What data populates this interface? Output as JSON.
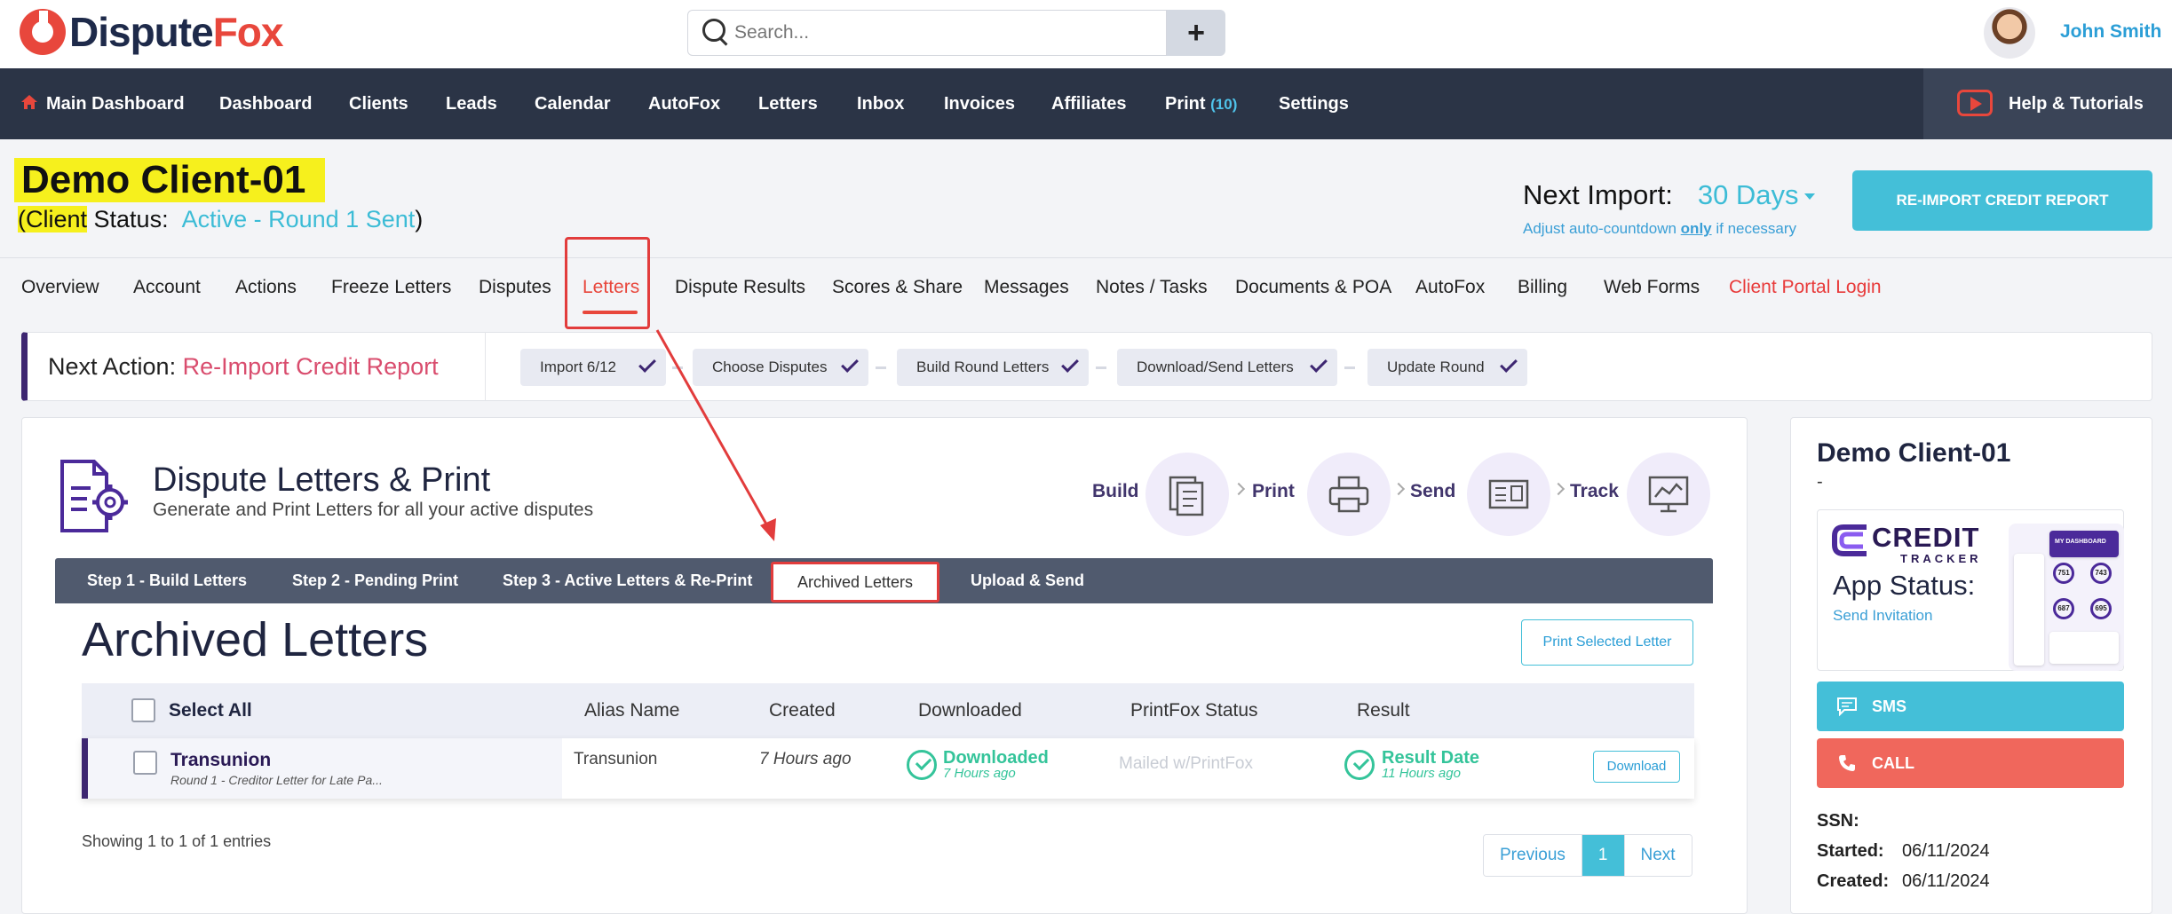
{
  "brand": {
    "name_part1": "Dispute",
    "name_part2": "Fox"
  },
  "search": {
    "placeholder": "Search..."
  },
  "add_button": "+",
  "user": {
    "name": "John Smith"
  },
  "nav": {
    "items": [
      {
        "label": "Main Dashboard"
      },
      {
        "label": "Dashboard"
      },
      {
        "label": "Clients"
      },
      {
        "label": "Leads"
      },
      {
        "label": "Calendar"
      },
      {
        "label": "AutoFox"
      },
      {
        "label": "Letters"
      },
      {
        "label": "Inbox"
      },
      {
        "label": "Invoices"
      },
      {
        "label": "Affiliates"
      },
      {
        "label": "Print",
        "count": "(10)"
      },
      {
        "label": "Settings"
      }
    ],
    "help": "Help & Tutorials"
  },
  "client": {
    "name": "Demo Client-01",
    "status_open": "(Client",
    "status_label": " Status:",
    "status_value": "Active - Round 1 Sent",
    "status_close": ")"
  },
  "next_import": {
    "label": "Next Import:",
    "value": "30 Days",
    "note_pre": "Adjust auto-countdown ",
    "note_bold": "only",
    "note_post": " if necessary",
    "button": "RE-IMPORT CREDIT REPORT"
  },
  "client_tabs": [
    "Overview",
    "Account",
    "Actions",
    "Freeze Letters",
    "Disputes",
    "Letters",
    "Dispute Results",
    "Scores & Share",
    "Messages",
    "Notes / Tasks",
    "Documents & POA",
    "AutoFox",
    "Billing",
    "Web Forms",
    "Client Portal Login"
  ],
  "active_client_tab": "Letters",
  "next_action": {
    "label": "Next Action:",
    "value": "Re-Import Credit Report",
    "steps": [
      "Import 6/12",
      "Choose Disputes",
      "Build Round Letters",
      "Download/Send Letters",
      "Update Round"
    ]
  },
  "letters_panel": {
    "title": "Dispute Letters & Print",
    "subtitle": "Generate and Print Letters for all your active disputes",
    "flow": [
      "Build",
      "Print",
      "Send",
      "Track"
    ],
    "tabs": [
      "Step 1 - Build Letters",
      "Step 2 - Pending Print",
      "Step 3 - Active Letters & Re-Print",
      "Archived Letters",
      "Upload & Send"
    ],
    "active_tab": "Archived Letters"
  },
  "archived": {
    "title": "Archived Letters",
    "print_selected": "Print Selected Letter",
    "columns": [
      "Select All",
      "Alias Name",
      "Created",
      "Downloaded",
      "PrintFox Status",
      "Result"
    ],
    "rows": [
      {
        "bureau": "Transunion",
        "letter": "Round 1 - Creditor Letter for Late Pa...",
        "alias": "Transunion",
        "created": "7 Hours ago",
        "downloaded": "Downloaded",
        "downloaded_ago": "7 Hours ago",
        "printfox_status": "Mailed w/PrintFox",
        "result": "Result Date",
        "result_ago": "11 Hours ago",
        "action": "Download"
      }
    ],
    "showing": "Showing 1 to 1 of 1 entries",
    "pager": {
      "prev": "Previous",
      "current": "1",
      "next": "Next"
    }
  },
  "side": {
    "name": "Demo Client-01",
    "dash": "-",
    "credit_tracker_word1": "CREDIT",
    "credit_tracker_word2": "TRACKER",
    "app_status": "App Status:",
    "send_invitation": "Send Invitation",
    "mock_header": "MY DASHBOARD",
    "mock_scores": [
      "751",
      "743",
      "687",
      "695"
    ],
    "sms": "SMS",
    "call": "CALL",
    "ssn_label": "SSN:",
    "ssn_value": "",
    "started_label": "Started:",
    "started_value": "06/11/2024",
    "created_label": "Created:",
    "created_value": "06/11/2024"
  },
  "colors": {
    "nav_bg": "#2b3446",
    "accent_teal": "#44bfd8",
    "accent_red": "#e8473c",
    "highlight_yellow": "#f6f01d",
    "brand_purple": "#3d2671",
    "success_green": "#34c49a"
  }
}
